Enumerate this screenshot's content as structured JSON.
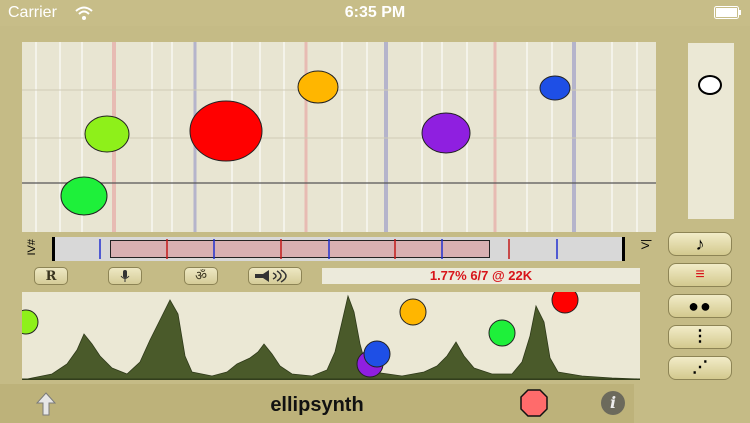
{
  "status_bar": {
    "carrier": "Carrier",
    "time": "6:35 PM"
  },
  "range": {
    "left_label": "IV#",
    "right_label": "V|"
  },
  "toolbar": {
    "readout": "1.77% 6/7 @ 22K",
    "icons": [
      "r-logo-icon",
      "microphone-icon",
      "om-icon",
      "speaker-icon"
    ]
  },
  "side_buttons": {
    "note": "♪",
    "lines": "≡",
    "dots_two": "●●",
    "dots_vertical": "⋮",
    "dots_diagonal": "⋰"
  },
  "app": {
    "title": "ellipsynth",
    "info_glyph": "i"
  },
  "colors": {
    "background": "#c5bb86",
    "panel": "#e8e5d2",
    "readout_text": "#d8141a",
    "spectrum_fill": "#4a5a2a"
  }
}
